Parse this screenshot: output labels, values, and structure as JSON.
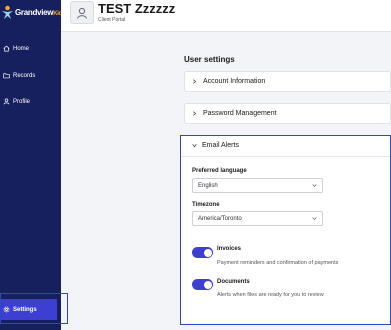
{
  "brand": {
    "logo_main": "Grandview",
    "logo_suffix": "Kids",
    "accent": "#3c3fd1",
    "sidebar_bg": "#16205e"
  },
  "header": {
    "title": "TEST Zzzzzz",
    "subtitle": "Client Portal",
    "avatar_icon": "user-icon"
  },
  "sidebar": {
    "items": [
      {
        "label": "Home",
        "icon": "home-icon"
      },
      {
        "label": "Records",
        "icon": "folder-icon"
      },
      {
        "label": "Profile",
        "icon": "user-icon"
      }
    ],
    "settings": {
      "label": "Settings",
      "icon": "gear-icon",
      "selected": true
    }
  },
  "main": {
    "title": "User settings",
    "sections": [
      {
        "label": "Account Information",
        "expanded": false
      },
      {
        "label": "Password Management",
        "expanded": false
      }
    ],
    "email_alerts": {
      "label": "Email Alerts",
      "expanded": true,
      "language": {
        "label": "Preferred language",
        "value": "English"
      },
      "timezone": {
        "label": "Timezone",
        "value": "America/Toronto"
      },
      "toggles": [
        {
          "title": "Invoices",
          "description": "Payment reminders and confirmation of payments",
          "on": true
        },
        {
          "title": "Documents",
          "description": "Alerts when files are ready for you to review",
          "on": true
        }
      ]
    }
  }
}
